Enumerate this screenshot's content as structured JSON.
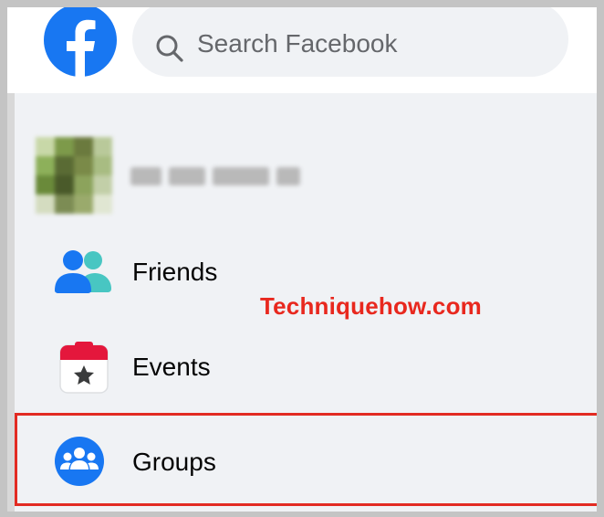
{
  "header": {
    "logo_icon": "facebook-logo-icon",
    "brand_color": "#1877f2",
    "search": {
      "placeholder": "Search Facebook",
      "icon": "search-icon"
    }
  },
  "profile": {
    "name": "Jim Doyle",
    "blurred": true
  },
  "sidebar": {
    "items": [
      {
        "label": "Friends",
        "icon": "friends-icon"
      },
      {
        "label": "Events",
        "icon": "calendar-star-icon"
      },
      {
        "label": "Groups",
        "icon": "groups-icon",
        "highlighted": true
      }
    ]
  },
  "watermark": {
    "text": "Techniquehow.com",
    "color": "#e8281e"
  },
  "highlight_color": "#e22b22"
}
